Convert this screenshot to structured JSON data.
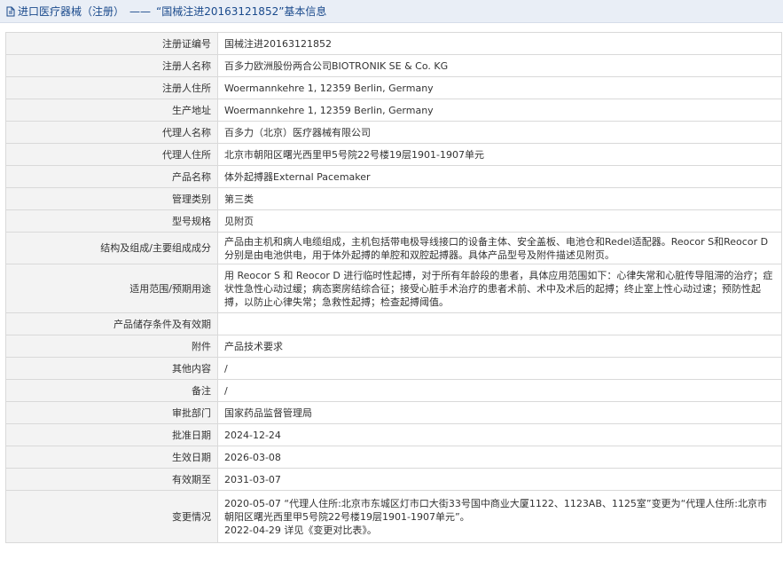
{
  "header": {
    "icon": "document-icon",
    "title": "进口医疗器械（注册）",
    "separator": "——",
    "record_title": "“国械注进20163121852”基本信息"
  },
  "rows": [
    {
      "label": "注册证编号",
      "value": "国械注进20163121852"
    },
    {
      "label": "注册人名称",
      "value": "百多力欧洲股份两合公司BIOTRONIK SE & Co. KG"
    },
    {
      "label": "注册人住所",
      "value": "Woermannkehre 1, 12359 Berlin, Germany"
    },
    {
      "label": "生产地址",
      "value": "Woermannkehre 1, 12359 Berlin, Germany"
    },
    {
      "label": "代理人名称",
      "value": "百多力（北京）医疗器械有限公司"
    },
    {
      "label": "代理人住所",
      "value": "北京市朝阳区曙光西里甲5号院22号楼19层1901-1907单元"
    },
    {
      "label": "产品名称",
      "value": "体外起搏器External Pacemaker"
    },
    {
      "label": "管理类别",
      "value": "第三类"
    },
    {
      "label": "型号规格",
      "value": "见附页"
    },
    {
      "label": "结构及组成/主要组成成分",
      "value": "产品由主机和病人电缆组成，主机包括带电极导线接口的设备主体、安全盖板、电池仓和Redel适配器。Reocor S和Reocor D分别是由电池供电，用于体外起搏的单腔和双腔起搏器。具体产品型号及附件描述见附页。"
    },
    {
      "label": "适用范围/预期用途",
      "value": "用 Reocor S 和 Reocor D 进行临时性起搏，对于所有年龄段的患者，具体应用范围如下：心律失常和心脏传导阻滞的治疗；症状性急性心动过缓；病态窦房结综合征；接受心脏手术治疗的患者术前、术中及术后的起搏；终止室上性心动过速；预防性起搏，以防止心律失常；急救性起搏；检查起搏阈值。"
    },
    {
      "label": "产品储存条件及有效期",
      "value": ""
    },
    {
      "label": "附件",
      "value": "产品技术要求"
    },
    {
      "label": "其他内容",
      "value": "/"
    },
    {
      "label": "备注",
      "value": "/"
    },
    {
      "label": "审批部门",
      "value": "国家药品监督管理局"
    },
    {
      "label": "批准日期",
      "value": "2024-12-24"
    },
    {
      "label": "生效日期",
      "value": "2026-03-08"
    },
    {
      "label": "有效期至",
      "value": "2031-03-07"
    }
  ],
  "change": {
    "label": "变更情况",
    "line1": "2020-05-07 “代理人住所:北京市东城区灯市口大街33号国中商业大厦1122、1123AB、1125室”变更为“代理人住所:北京市朝阳区曙光西里甲5号院22号楼19层1901-1907单元”。",
    "line2": "2022-04-29 详见《变更对比表》。"
  }
}
